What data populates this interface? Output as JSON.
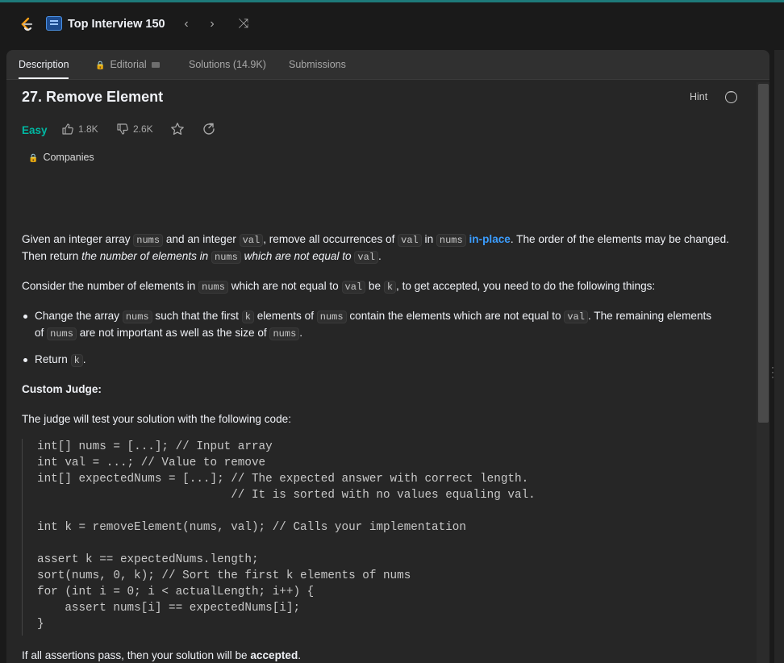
{
  "topbar": {
    "plan_title": "Top Interview 150",
    "prev_label": "‹",
    "next_label": "›",
    "shuffle_label": "⤨"
  },
  "tabs": [
    {
      "label": "Description",
      "active": true
    },
    {
      "label": "Editorial",
      "locked": true
    },
    {
      "label": "Solutions (14.9K)"
    },
    {
      "label": "Submissions"
    }
  ],
  "problem": {
    "title": "27. Remove Element",
    "hint_label": "Hint",
    "difficulty": "Easy",
    "likes": "1.8K",
    "dislikes": "2.6K",
    "companies_label": "Companies"
  },
  "description": {
    "p1_a": "Given an integer array ",
    "p1_b": "nums",
    "p1_c": " and an integer ",
    "p1_d": "val",
    "p1_e": ", remove all occurrences of ",
    "p1_f": "val",
    "p1_g": " in ",
    "p1_h": "nums",
    "p1_i": "in-place",
    "p1_j": ". The order of the elements may be changed.",
    "p1_line2_a": "Then return ",
    "p1_line2_b": "the number of elements in ",
    "p1_line2_c": "nums",
    "p1_line2_d": " which are not equal to ",
    "p1_line2_e": "val",
    "p1_line2_f": ".",
    "p2_a": "Consider the number of elements in ",
    "p2_b": "nums",
    "p2_c": " which are not equal to ",
    "p2_d": "val",
    "p2_e": " be ",
    "p2_f": "k",
    "p2_g": ", to get accepted, you need to do the following things:",
    "b1_a": "Change the array ",
    "b1_b": "nums",
    "b1_c": " such that the first ",
    "b1_d": "k",
    "b1_e": " elements of ",
    "b1_f": "nums",
    "b1_g": " contain the elements which are not equal to ",
    "b1_h": "val",
    "b1_i": ". The remaining elements",
    "b1_line2_a": "of ",
    "b1_line2_b": "nums",
    "b1_line2_c": " are not important as well as the size of ",
    "b1_line2_d": "nums",
    "b1_line2_e": ".",
    "b2_a": "Return ",
    "b2_b": "k",
    "b2_c": ".",
    "judge_heading": "Custom Judge:",
    "judge_text": "The judge will test your solution with the following code:",
    "code_lines": [
      "int[] nums = [...]; // Input array",
      "int val = ...; // Value to remove",
      "int[] expectedNums = [...]; // The expected answer with correct length.",
      "                            // It is sorted with no values equaling val.",
      "",
      "int k = removeElement(nums, val); // Calls your implementation",
      "",
      "assert k == expectedNums.length;",
      "sort(nums, 0, k); // Sort the first k elements of nums",
      "for (int i = 0; i < actualLength; i++) {",
      "    assert nums[i] == expectedNums[i];",
      "}"
    ],
    "final_a": "If all assertions pass, then your solution will be ",
    "final_b": "accepted",
    "final_c": "."
  },
  "colors": {
    "accent_easy": "#00b8a3",
    "link_blue": "#3b9dff",
    "lock_gold": "#ffb800"
  }
}
